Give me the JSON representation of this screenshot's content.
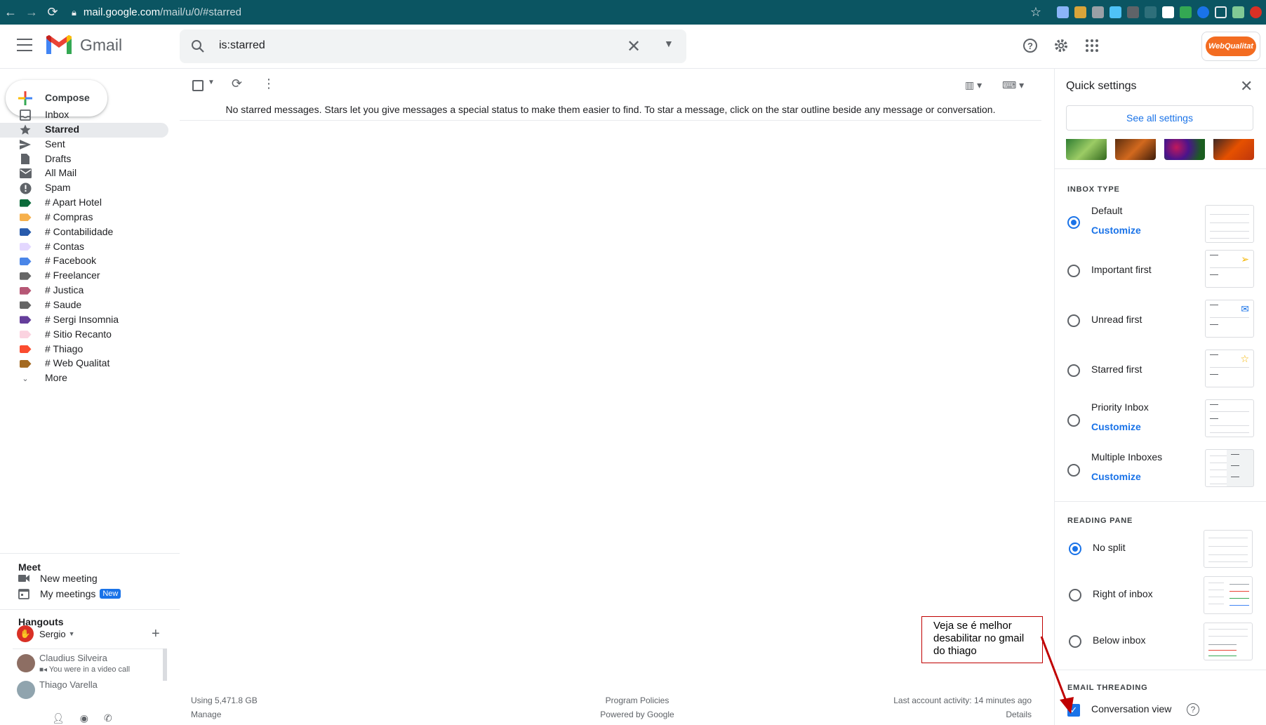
{
  "browser": {
    "url_host": "mail.google.com",
    "url_path": "/mail/u/0/#starred"
  },
  "app": {
    "name": "Gmail"
  },
  "search": {
    "value": "is:starred"
  },
  "compose": {
    "label": "Compose"
  },
  "nav": {
    "items": [
      {
        "label": "Inbox",
        "icon": "inbox-icon"
      },
      {
        "label": "Starred",
        "icon": "star-icon",
        "active": true
      },
      {
        "label": "Sent",
        "icon": "send-icon"
      },
      {
        "label": "Drafts",
        "icon": "draft-icon"
      },
      {
        "label": "All Mail",
        "icon": "mail-icon"
      },
      {
        "label": "Spam",
        "icon": "spam-icon"
      },
      {
        "label": "# Apart Hotel",
        "color": "#0b6b3a"
      },
      {
        "label": "# Compras",
        "color": "#f6b04b"
      },
      {
        "label": "# Contabilidade",
        "color": "#285bac"
      },
      {
        "label": "# Contas",
        "color": "#e3d7ff"
      },
      {
        "label": "# Facebook",
        "color": "#4a86e8"
      },
      {
        "label": "# Freelancer",
        "color": "#666666"
      },
      {
        "label": "# Justica",
        "color": "#b65775"
      },
      {
        "label": "# Saude",
        "color": "#666666"
      },
      {
        "label": "# Sergi Insomnia",
        "color": "#653e9b"
      },
      {
        "label": "# Sitio Recanto",
        "color": "#fbd3e0"
      },
      {
        "label": "# Thiago",
        "color": "#fb4c2f"
      },
      {
        "label": "# Web Qualitat",
        "color": "#a46a21"
      }
    ],
    "more_label": "More"
  },
  "meet": {
    "title": "Meet",
    "new_meeting": "New meeting",
    "my_meetings": "My meetings",
    "new_badge": "New"
  },
  "hangouts": {
    "title": "Hangouts",
    "user": "Sergio",
    "contacts": [
      {
        "name": "Claudius Silveira",
        "status": "You were in a video call"
      },
      {
        "name": "Thiago Varella",
        "status": ""
      }
    ]
  },
  "main": {
    "empty_message": "No starred messages. Stars let you give messages a special status to make them easier to find. To star a message, click on the star outline beside any message or conversation.",
    "footer": {
      "storage": "Using 5,471.8 GB",
      "manage": "Manage",
      "policies": "Program Policies",
      "powered": "Powered by Google",
      "activity": "Last account activity: 14 minutes ago",
      "details": "Details"
    }
  },
  "quick_settings": {
    "title": "Quick settings",
    "see_all": "See all settings",
    "inbox_type_title": "INBOX TYPE",
    "inbox_types": [
      {
        "label": "Default",
        "customize": "Customize",
        "selected": true
      },
      {
        "label": "Important first",
        "customize": ""
      },
      {
        "label": "Unread first",
        "customize": ""
      },
      {
        "label": "Starred first",
        "customize": ""
      },
      {
        "label": "Priority Inbox",
        "customize": "Customize"
      },
      {
        "label": "Multiple Inboxes",
        "customize": "Customize"
      }
    ],
    "reading_pane_title": "READING PANE",
    "reading_pane": [
      {
        "label": "No split",
        "selected": true
      },
      {
        "label": "Right of inbox"
      },
      {
        "label": "Below inbox"
      }
    ],
    "threading_title": "EMAIL THREADING",
    "conversation_view": "Conversation view",
    "conversation_view_checked": true
  },
  "annotation": {
    "text": "Veja se é melhor desabilitar no gmail do thiago",
    "border_color": "#c00000"
  },
  "colors": {
    "accent": "#1a73e8",
    "browser_bar": "#0b5562"
  }
}
